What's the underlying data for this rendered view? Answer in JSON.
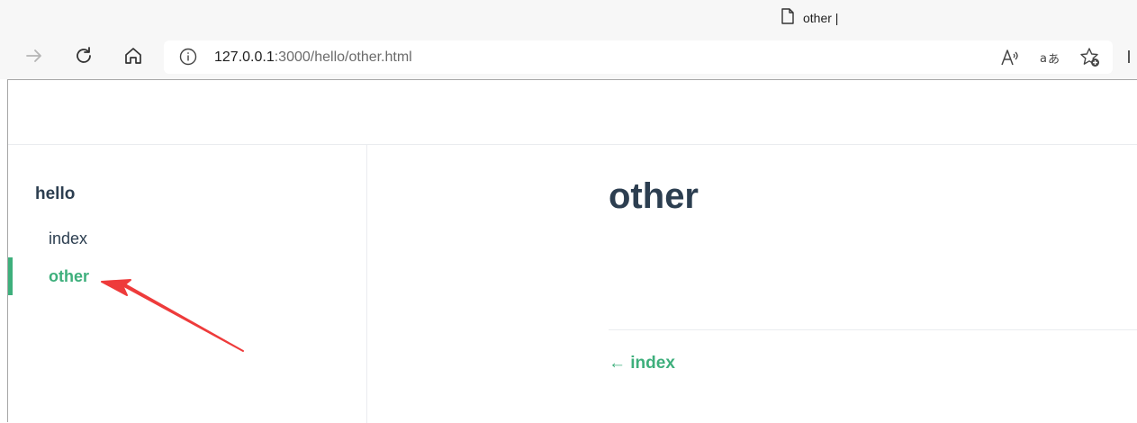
{
  "browser": {
    "tab_title": "other |",
    "url_host": "127.0.0.1",
    "url_rest": ":3000/hello/other.html",
    "icons": [
      "forward-icon",
      "reload-icon",
      "home-icon",
      "info-icon",
      "read-aloud-icon",
      "translate-icon",
      "add-favorite-icon",
      "page-icon"
    ]
  },
  "sidebar": {
    "group_title": "hello",
    "items": [
      {
        "label": "index",
        "active": false
      },
      {
        "label": "other",
        "active": true
      }
    ]
  },
  "main": {
    "title": "other",
    "prev_link": "← index"
  },
  "colors": {
    "accent": "#3eaf7c",
    "text": "#2c3e50",
    "annotation_arrow": "#ee3b3b"
  }
}
